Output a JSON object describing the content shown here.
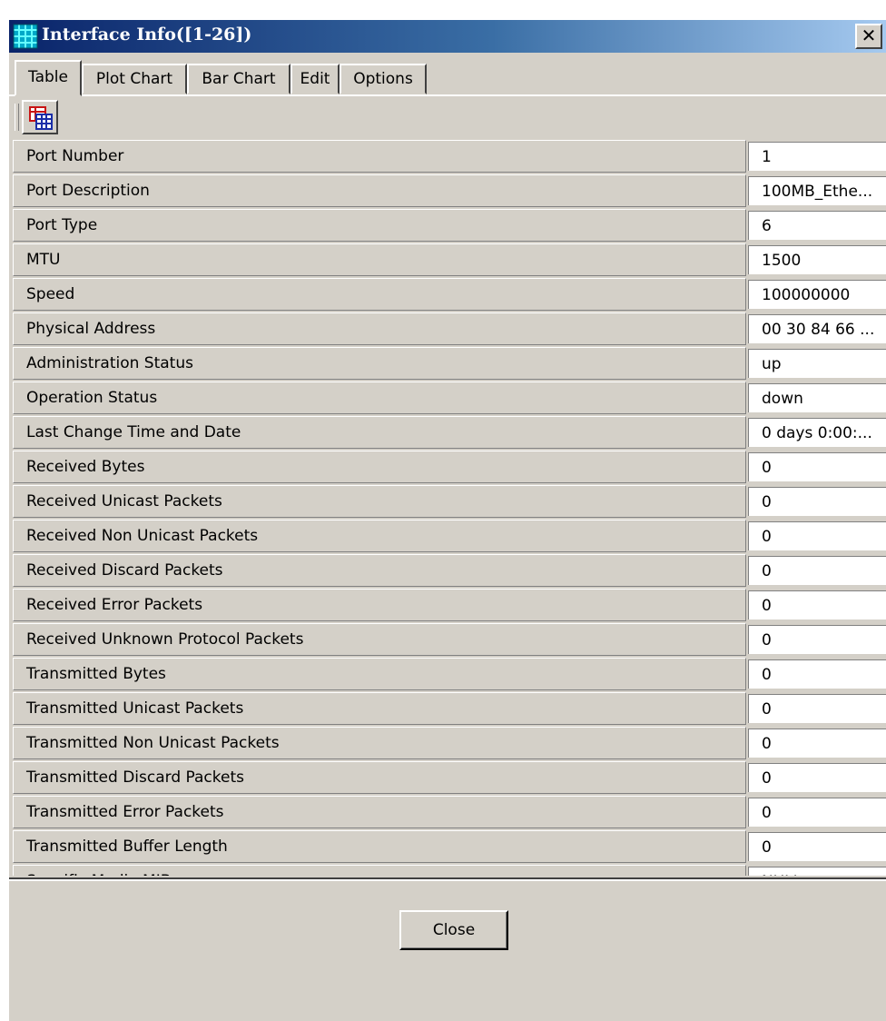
{
  "window": {
    "title": "Interface Info([1-26])",
    "close_glyph": "✕",
    "icon": "grid-app-icon"
  },
  "tabs": [
    {
      "label": "Table",
      "active": true
    },
    {
      "label": "Plot Chart",
      "active": false
    },
    {
      "label": "Bar Chart",
      "active": false
    },
    {
      "label": "Edit",
      "active": false
    },
    {
      "label": "Options",
      "active": false
    }
  ],
  "toolbar": {
    "button_icon": "table-view-icon"
  },
  "table": {
    "rows": [
      {
        "label": "Port Number",
        "value": "1"
      },
      {
        "label": "Port Description",
        "value": "100MB_Ethe..."
      },
      {
        "label": "Port Type",
        "value": "6"
      },
      {
        "label": "MTU",
        "value": "1500"
      },
      {
        "label": "Speed",
        "value": "100000000"
      },
      {
        "label": "Physical Address",
        "value": "00 30 84 66 ..."
      },
      {
        "label": "Administration Status",
        "value": "up"
      },
      {
        "label": "Operation Status",
        "value": "down"
      },
      {
        "label": "Last Change Time and Date",
        "value": "0 days 0:00:..."
      },
      {
        "label": "Received Bytes",
        "value": "0"
      },
      {
        "label": "Received Unicast Packets",
        "value": "0"
      },
      {
        "label": "Received Non Unicast Packets",
        "value": "0"
      },
      {
        "label": "Received Discard Packets",
        "value": "0"
      },
      {
        "label": "Received Error Packets",
        "value": "0"
      },
      {
        "label": "Received Unknown Protocol Packets",
        "value": "0"
      },
      {
        "label": "Transmitted Bytes",
        "value": "0"
      },
      {
        "label": "Transmitted Unicast Packets",
        "value": "0"
      },
      {
        "label": "Transmitted Non Unicast Packets",
        "value": "0"
      },
      {
        "label": "Transmitted Discard Packets",
        "value": "0"
      },
      {
        "label": "Transmitted Error Packets",
        "value": "0"
      },
      {
        "label": "Transmitted Buffer Length",
        "value": "0"
      },
      {
        "label": "Specific Media MIB",
        "value": "NULL"
      }
    ]
  },
  "footer": {
    "close_label": "Close"
  },
  "colors": {
    "titlebar_start": "#0a246a",
    "titlebar_end": "#a6caf0",
    "face": "#d4d0c8"
  }
}
